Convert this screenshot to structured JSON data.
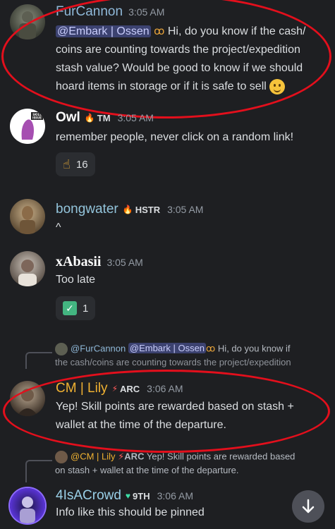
{
  "messages": [
    {
      "username": "FurCannon",
      "time": "3:05 AM",
      "mention": "@Embark | Ossen",
      "lines": [
        "Hi, do you know if the cash/",
        "coins are counting towards the project/expedition",
        "stash value? Would be good to know if we should",
        "hoard items in storage or if it is safe to sell"
      ],
      "emoji": "slightly-smiling-face"
    },
    {
      "username": "Owl",
      "tag": "TM",
      "time": "3:05 AM",
      "text": "remember people, never click on a random link!",
      "avatar_text": "SKILL ISSUE",
      "reaction": {
        "emoji": "point-up",
        "count": "16"
      }
    },
    {
      "username": "bongwater",
      "tag": "HSTR",
      "time": "3:05 AM",
      "text": "^"
    },
    {
      "username": "xAbasii",
      "time": "3:05 AM",
      "text": "Too late",
      "reaction": {
        "emoji": "check-mark",
        "count": "1"
      }
    },
    {
      "reply_to": {
        "username": "@FurCannon",
        "mention": "@Embark | Ossen",
        "text_line1": "Hi, do you know if",
        "text_line2": "the cash/coins are counting towards the project/expedition"
      },
      "username": "CM | Lily",
      "tag": "ARC",
      "time": "3:06 AM",
      "lines": [
        "Yep! Skill points are rewarded based on stash +",
        "wallet at the time of the departure."
      ]
    },
    {
      "reply_to": {
        "username": "@CM | Lily",
        "tag": "ARC",
        "text_line1": "Yep! Skill points are rewarded based",
        "text_line2": "on stash + wallet at the time of the departure."
      },
      "username": "4IsACrowd",
      "tag": "9TH",
      "time": "3:06 AM",
      "text": "Info like this should be pinned"
    }
  ],
  "colors": {
    "background": "#1e1f22",
    "mention_bg": "#3c4270",
    "furcannon": "#8fb8d8",
    "owl": "#ffffff",
    "bongwater": "#93c4db",
    "xabasii": "#ffffff",
    "lily": "#f0b232",
    "crowd": "#9ad0e8",
    "annotation": "#e30f1c"
  }
}
